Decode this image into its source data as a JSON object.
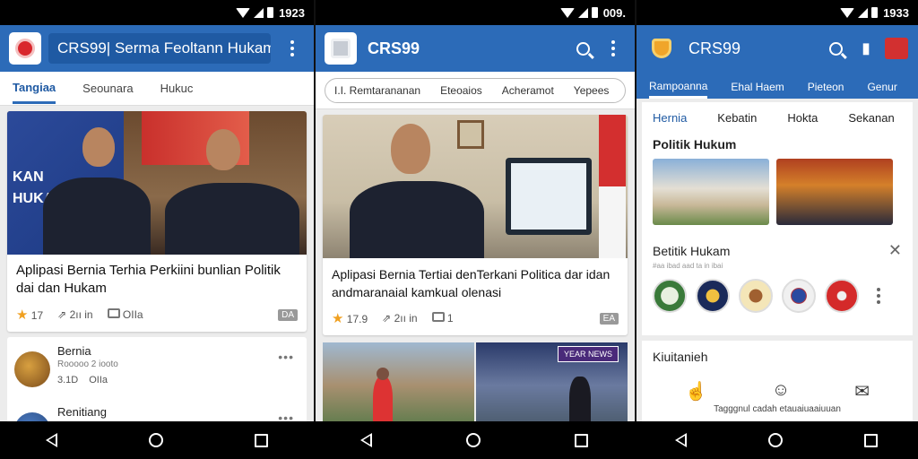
{
  "screen1": {
    "status_time": "1923",
    "app_title": "CRS99| Serma Feoltann Hukam",
    "tabs": [
      "Tangiaa",
      "Seounara",
      "Hukuc"
    ],
    "card": {
      "title": "Aplipasi Bernia Terhia Perkiini bunlian Politik dai dan Hukam",
      "meta": [
        "17",
        "2ıı in",
        "OIIa"
      ],
      "tag": "DA"
    },
    "list": [
      {
        "title": "Bernia",
        "subtitle": "Rooooo 2 iooto",
        "meta": [
          "3.1D",
          "OIIa"
        ]
      },
      {
        "title": "Renitiang",
        "subtitle": "",
        "meta": []
      }
    ]
  },
  "screen2": {
    "status_time": "009.",
    "app_title": "CRS99",
    "tabs": [
      "I.I. Remtarananan",
      "Eteoaios",
      "Acheramot",
      "Yepees"
    ],
    "card": {
      "title": "Aplipasi Bernia Tertiai denTerkani Politica dar idan andmaranaial kamkual olenasi",
      "meta": [
        "17.9",
        "2ıı in",
        "1"
      ],
      "tag": "EA"
    },
    "image_badge": "YEAR NEWS"
  },
  "screen3": {
    "status_time": "1933",
    "app_title": "CRS99",
    "tabs": [
      "Rampoanna",
      "Ehal Haem",
      "Pieteon",
      "Genur"
    ],
    "subtabs": [
      "Hernia",
      "Kebatin",
      "Hokta",
      "Sekanan"
    ],
    "section1_title": "Politik Hukum",
    "section2_title": "Betitik Hukam",
    "section2_sub": "#aa ibad aad ta in ibai",
    "lower_title": "Kiuitanieh",
    "lower_caption": "Tagggnul cadah etauaiuaaiuuan"
  },
  "colors": {
    "appbar": "#2c6bb8",
    "accent": "#1f5aa3"
  }
}
